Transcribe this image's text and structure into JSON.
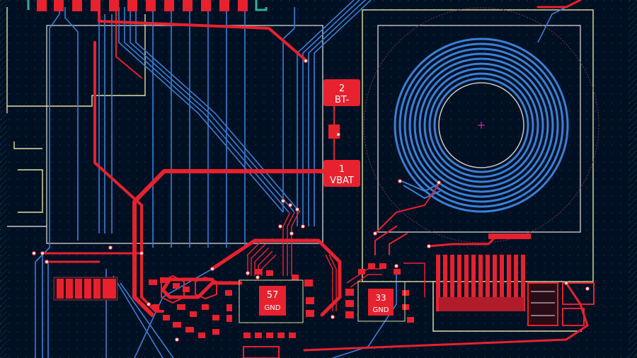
{
  "colors": {
    "background": "#001023",
    "front_copper": "#e8212e",
    "back_copper": "#3a7fd5",
    "silkscreen": "#e0e0a0",
    "outline": "#c8c8c8",
    "pad": "#ff3a48",
    "via": "#c8c8c8",
    "highlight": "#d42a9a"
  },
  "pads": [
    {
      "id": "bt_minus",
      "number": "2",
      "net": "BT-"
    },
    {
      "id": "vbat",
      "number": "1",
      "net": "VBAT"
    }
  ],
  "chips": [
    {
      "id": "u_left",
      "number": "57",
      "net": "GND"
    },
    {
      "id": "u_right",
      "number": "33",
      "net": "GND"
    }
  ],
  "coil": {
    "label": "wireless charging coil"
  }
}
